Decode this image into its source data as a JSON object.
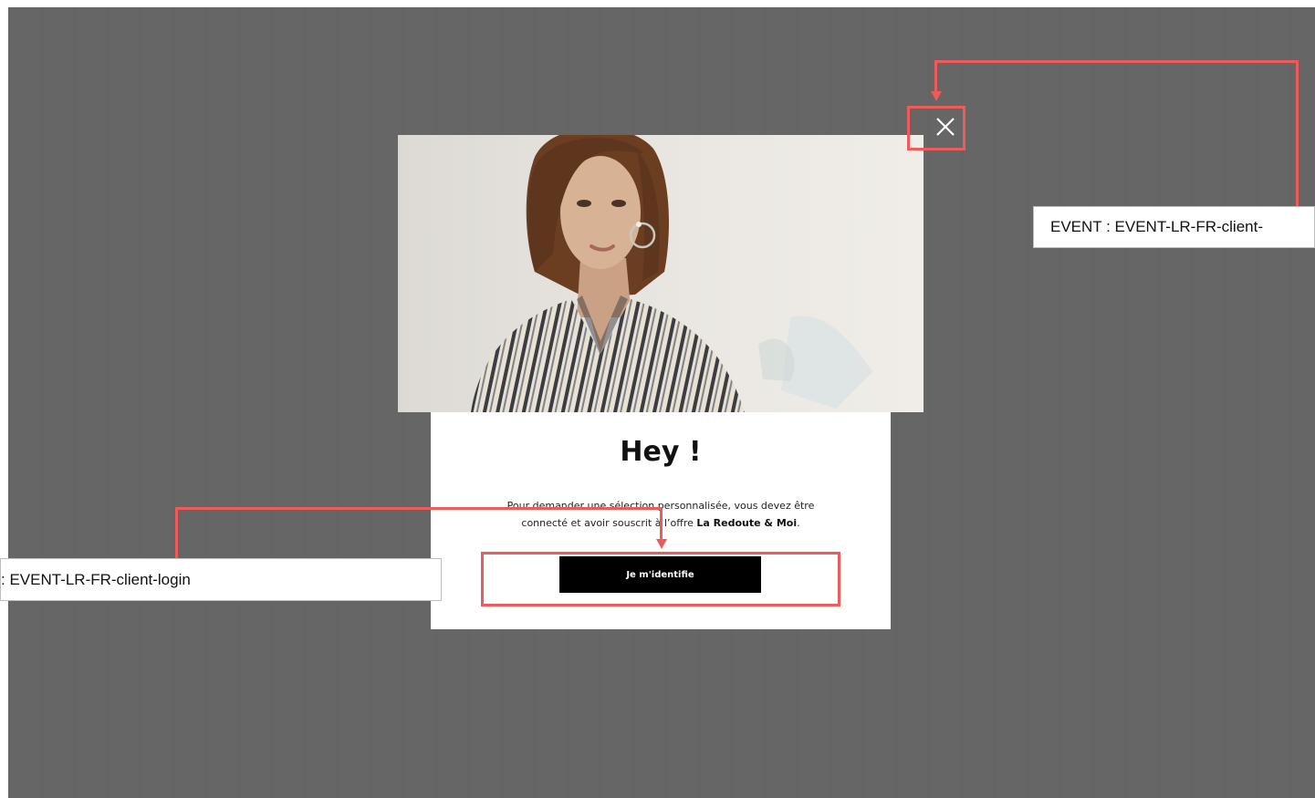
{
  "modal": {
    "title": "Hey !",
    "text_line1": "Pour demander une sélection personnalisée, vous devez être",
    "text_line2_prefix": "connecté et avoir souscrit à l’offre ",
    "text_line2_bold": "La Redoute & Moi",
    "text_line2_suffix": ".",
    "login_button_label": "Je m'identifie"
  },
  "close_button": {
    "icon": "close-icon"
  },
  "annotations": {
    "close_event_label": "EVENT : EVENT-LR-FR-client-",
    "login_event_label": ": EVENT-LR-FR-client-login"
  },
  "colors": {
    "overlay": "#666666",
    "annotation_red": "#ef5a5a",
    "button_bg": "#000000",
    "button_text": "#ffffff"
  }
}
